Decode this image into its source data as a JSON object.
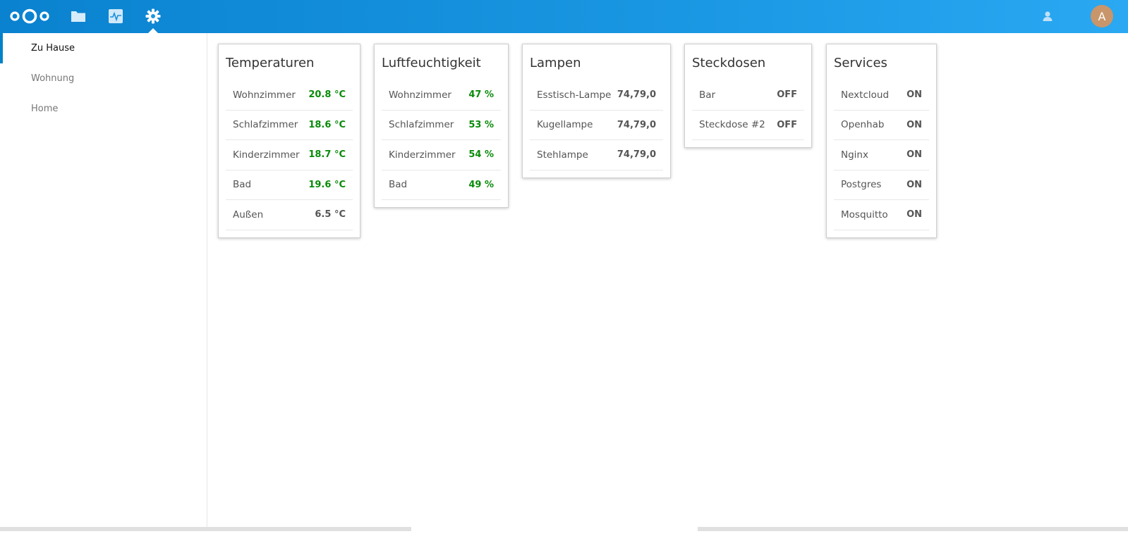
{
  "header": {
    "apps": [
      {
        "icon": "files-icon"
      },
      {
        "icon": "activity-icon"
      },
      {
        "icon": "settings-icon"
      }
    ],
    "avatar_letter": "A",
    "accent": "#0082c9"
  },
  "sidebar": {
    "items": [
      {
        "label": "Zu Hause"
      },
      {
        "label": "Wohnung"
      },
      {
        "label": "Home"
      }
    ]
  },
  "cards": [
    {
      "title": "Temperaturen",
      "rows": [
        {
          "label": "Wohnzimmer",
          "value": "20.8 °C"
        },
        {
          "label": "Schlafzimmer",
          "value": "18.6 °C"
        },
        {
          "label": "Kinderzimmer",
          "value": "18.7 °C"
        },
        {
          "label": "Bad",
          "value": "19.6 °C"
        },
        {
          "label": "Außen",
          "value": "6.5 °C"
        }
      ]
    },
    {
      "title": "Luftfeuchtigkeit",
      "rows": [
        {
          "label": "Wohnzimmer",
          "value": "47 %"
        },
        {
          "label": "Schlafzimmer",
          "value": "53 %"
        },
        {
          "label": "Kinderzimmer",
          "value": "54 %"
        },
        {
          "label": "Bad",
          "value": "49 %"
        }
      ]
    },
    {
      "title": "Lampen",
      "rows": [
        {
          "label": "Esstisch-Lampe",
          "value": "74,79,0"
        },
        {
          "label": "Kugellampe",
          "value": "74,79,0"
        },
        {
          "label": "Stehlampe",
          "value": "74,79,0"
        }
      ]
    },
    {
      "title": "Steckdosen",
      "rows": [
        {
          "label": "Bar",
          "value": "OFF"
        },
        {
          "label": "Steckdose #2",
          "value": "OFF"
        }
      ]
    },
    {
      "title": "Services",
      "rows": [
        {
          "label": "Nextcloud",
          "value": "ON"
        },
        {
          "label": "Openhab",
          "value": "ON"
        },
        {
          "label": "Nginx",
          "value": "ON"
        },
        {
          "label": "Postgres",
          "value": "ON"
        },
        {
          "label": "Mosquitto",
          "value": "ON"
        }
      ]
    }
  ],
  "colors": {
    "value_good": "#0a8a0a",
    "value_neutral": "#555555"
  }
}
